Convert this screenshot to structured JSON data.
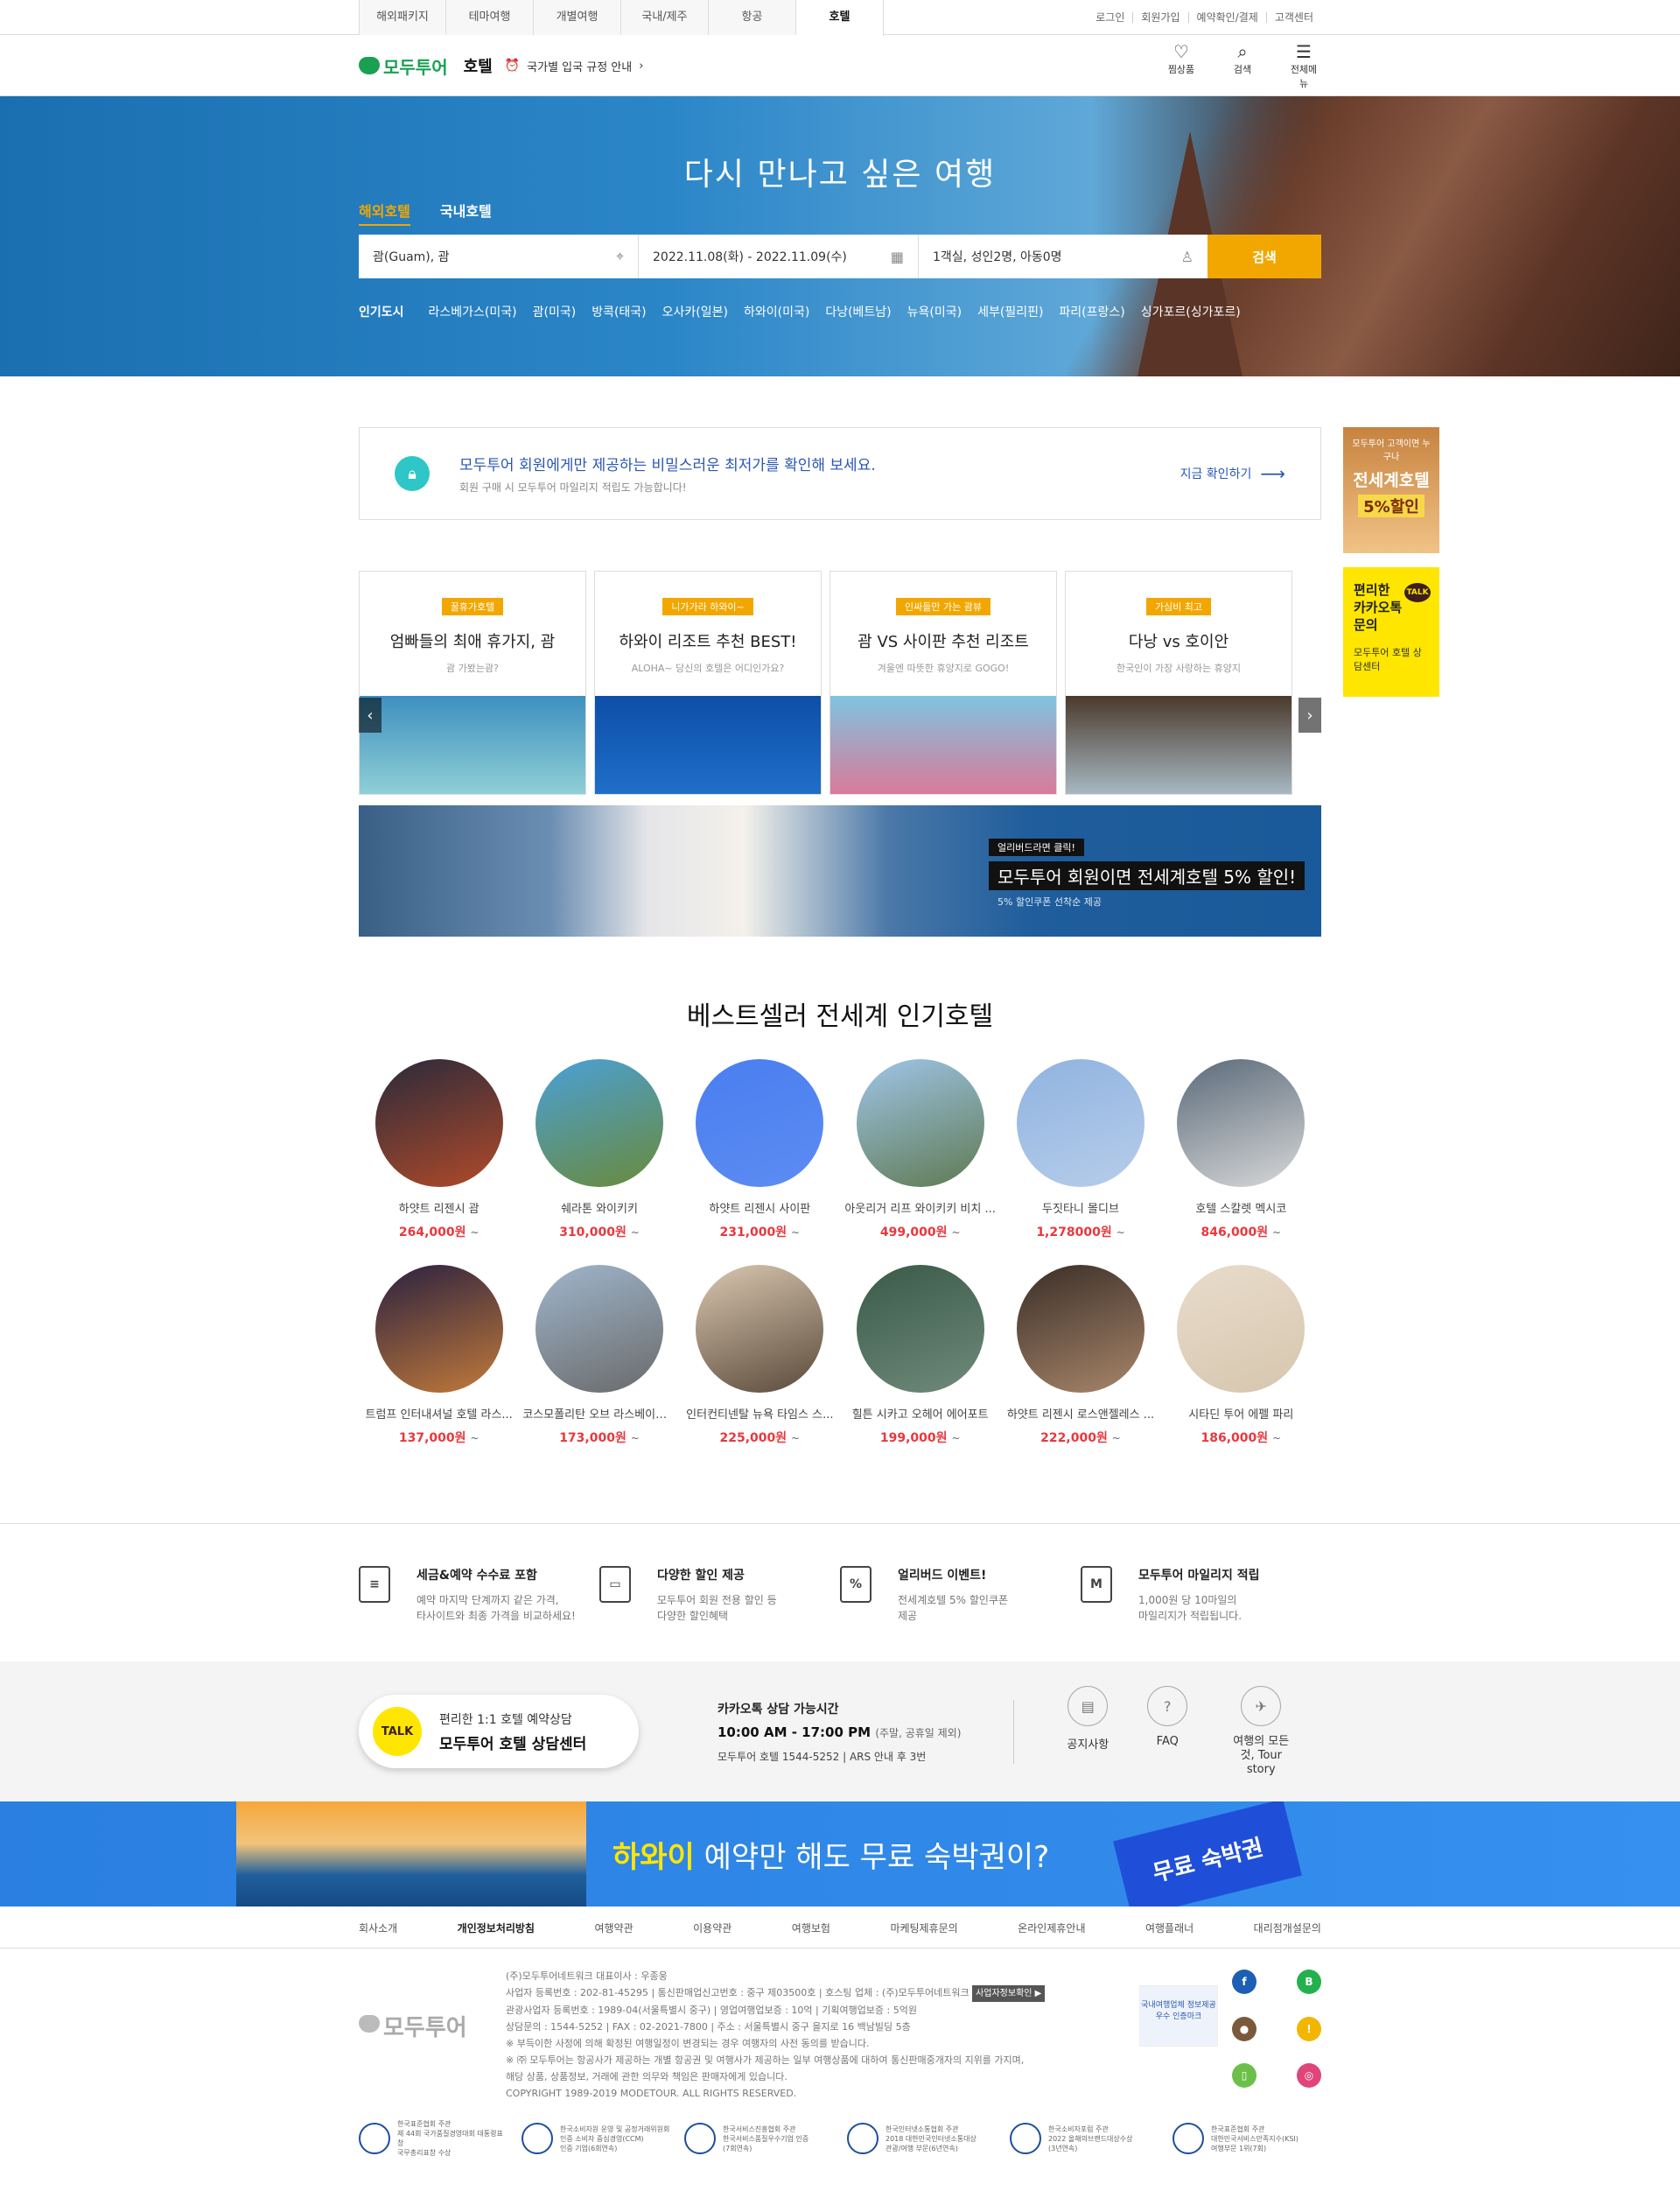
{
  "top_tabs": [
    "해외패키지",
    "테마여행",
    "개별여행",
    "국내/제주",
    "항공",
    "호텔"
  ],
  "top_active": "호텔",
  "util_links": [
    "로그인",
    "회원가입",
    "예약확인/결제",
    "고객센터"
  ],
  "header": {
    "logo": "모두투어",
    "section": "호텔",
    "entry_notice": "국가별 입국 규정 안내",
    "icons": [
      {
        "icon": "heart-icon",
        "label": "찜상품"
      },
      {
        "icon": "search-icon",
        "label": "검색"
      },
      {
        "icon": "menu-icon",
        "label": "전체메뉴"
      }
    ]
  },
  "hero": {
    "title": "다시 만나고 싶은 여행",
    "tabs": [
      "해외호텔",
      "국내호텔"
    ],
    "destination": "괌(Guam), 괌",
    "dates": "2022.11.08(화) - 2022.11.09(수)",
    "guests": "1객실, 성인2명, 아동0명",
    "search_btn": "검색",
    "popular_label": "인기도시",
    "popular_cities": [
      "라스베가스(미국)",
      "괌(미국)",
      "방콕(태국)",
      "오사카(일본)",
      "하와이(미국)",
      "다낭(베트남)",
      "뉴욕(미국)",
      "세부(필리핀)",
      "파리(프랑스)",
      "싱가포르(싱가포르)"
    ]
  },
  "member": {
    "title": "모두투어 회원에게만 제공하는 비밀스러운 최저가를 확인해 보세요.",
    "sub": "회원 구매 시 모두투어 마일리지 적립도 가능합니다!",
    "link": "지금 확인하기"
  },
  "side": {
    "b1_top": "모두투어 고객이면 누구나",
    "b1_title": "전세계호텔",
    "b1_badge": "5%할인",
    "b2_title": "편리한 카카오톡 문의",
    "b2_sub": "모두투어 호텔 상담센터",
    "b2_talk": "TALK"
  },
  "cards": [
    {
      "tag": "꿀휴가호텔",
      "title": "엄빠들의 최애 휴가지, 괌",
      "sub": "괌 가봤는괌?",
      "color1": "#3e8fc0",
      "color2": "#8fd0d6"
    },
    {
      "tag": "니가가라 하와이~",
      "title": "하와이 리조트 추천 BEST!",
      "sub": "ALOHA~ 당신의 호텔은 어디인가요?",
      "color1": "#0d4ea8",
      "color2": "#1f6fc9"
    },
    {
      "tag": "인싸들만 가는 괌뷰",
      "title": "괌 VS 사이판 추천 리조트",
      "sub": "겨울엔 따뜻한 휴양지로 GOGO!",
      "color1": "#7fc4e0",
      "color2": "#d97a9a"
    },
    {
      "tag": "가심비 최고",
      "title": "다낭 vs 호이안",
      "sub": "한국인이 가장 사랑하는 휴양지",
      "color1": "#4a3a2c",
      "color2": "#a7b8c2"
    }
  ],
  "banner": {
    "label": "얼리버드라면 클릭!",
    "title": "모두투어 회원이면 전세계호텔 5% 할인!",
    "sub": "5% 할인쿠폰 선착순 제공"
  },
  "best": {
    "title": "베스트셀러 전세계 인기호텔",
    "hotels": [
      {
        "name": "하얏트 리젠시 괌",
        "price": "264,000원",
        "c1": "#2a2a3a",
        "c2": "#b04a2a"
      },
      {
        "name": "쉐라톤 와이키키",
        "price": "310,000원",
        "c1": "#4aa0d8",
        "c2": "#6a8a3a"
      },
      {
        "name": "하얏트 리젠시 사이판",
        "price": "231,000원",
        "c1": "#4a7ef0",
        "c2": "#5c8cf2"
      },
      {
        "name": "아웃리거 리프 와이키키 비치 ...",
        "price": "499,000원",
        "c1": "#9fc5e8",
        "c2": "#5f7a52"
      },
      {
        "name": "두짓타니 몰디브",
        "price": "1,278000원",
        "c1": "#8fb3e0",
        "c2": "#b7cdea"
      },
      {
        "name": "호텔 스칼렛 멕시코",
        "price": "846,000원",
        "c1": "#5a6a7a",
        "c2": "#d8d8d8"
      },
      {
        "name": "트럼프 인터내셔널 호텔 라스...",
        "price": "137,000원",
        "c1": "#2a2140",
        "c2": "#c27a3a"
      },
      {
        "name": "코스모폴리탄 오브 라스베이거...",
        "price": "173,000원",
        "c1": "#9fb6cc",
        "c2": "#6a6a6a"
      },
      {
        "name": "인터컨티넨탈 뉴욕 타임스 스...",
        "price": "225,000원",
        "c1": "#d9c7b0",
        "c2": "#5a4a3a"
      },
      {
        "name": "힐튼 시카고 오헤어 에어포트",
        "price": "199,000원",
        "c1": "#3a5a48",
        "c2": "#6f8a7a"
      },
      {
        "name": "하얏트 리젠시 로스앤젤레스 ...",
        "price": "222,000원",
        "c1": "#3a2e28",
        "c2": "#a8866a"
      },
      {
        "name": "시타딘 투어 에펠 파리",
        "price": "186,000원",
        "c1": "#e8dccb",
        "c2": "#d6c6ae"
      }
    ],
    "price_suffix": "~"
  },
  "features": [
    {
      "icon": "receipt-icon",
      "glyph": "≡",
      "title": "세금&예약 수수료 포함",
      "desc1": "예약 마지막 단계까지 같은 가격,",
      "desc2": "타사이트와 최종 가격을 비교하세요!"
    },
    {
      "icon": "card-icon",
      "glyph": "▭",
      "title": "다양한 할인 제공",
      "desc1": "모두투어 회원 전용 할인 등",
      "desc2": "다양한 할인혜택"
    },
    {
      "icon": "coupon-icon",
      "glyph": "%",
      "title": "얼리버드 이벤트!",
      "desc1": "전세계호텔 5% 할인쿠폰",
      "desc2": "제공"
    },
    {
      "icon": "coins-icon",
      "glyph": "M",
      "title": "모두투어 마일리지 적립",
      "desc1": "1,000원 당 10마일의",
      "desc2": "마일리지가 적립됩니다."
    }
  ],
  "consult": {
    "talk": "TALK",
    "t1": "편리한 1:1 호텔 예약상담",
    "t2": "모두투어 호텔 상담센터",
    "hours_title": "카카오톡 상담 가능시간",
    "hours": "10:00 AM - 17:00 PM",
    "hours_note": "(주말, 공휴일 제외)",
    "phone": "모두투어 호텔 1544-5252  |  ARS 안내 후 3번",
    "links": [
      {
        "icon": "notice-icon",
        "glyph": "▤",
        "label": "공지사항"
      },
      {
        "icon": "faq-icon",
        "glyph": "?",
        "label": "FAQ"
      },
      {
        "icon": "plane-icon",
        "glyph": "✈",
        "label": "여행의 모든것, Tour story"
      }
    ]
  },
  "hawaii": {
    "hl": "하와이",
    "text": "예약만 해도 무료 숙박권이?",
    "ticket": "무료 숙박권"
  },
  "footer": {
    "links": [
      "회사소개",
      "개인정보처리방침",
      "여행약관",
      "이용약관",
      "여행보험",
      "마케팅제휴문의",
      "온라인제휴안내",
      "여행플래너",
      "대리점개설문의"
    ],
    "bold_link": "개인정보처리방침",
    "logo": "모두투어",
    "lines": [
      "(주)모두투어네트워크 대표이사 : 우종웅",
      "사업자 등록번호 : 202-81-45295 | 통신판매업신고번호 : 중구 제03500호 | 호스팅 업체 : (주)모두투어네트워크",
      "관광사업자 등록번호 : 1989-04(서울특별시 중구) | 영업여행업보증 : 10억 | 기획여행업보증 : 5억원",
      "상담문의 : 1544-5252 | FAX : 02-2021-7800 | 주소 : 서울특별시 중구 을지로 16 백남빌딩 5층",
      "※ 부득이한 사정에 의해 확정된 여행일정이 변경되는 경우 여행자의 사전 동의를 받습니다.",
      "※ ㈜ 모두투어는 항공사가 제공하는 개별 항공권 및 여행사가 제공하는 일부 여행상품에 대하여 통신판매중개자의 지위를 가지며,",
      "해당 상품, 상품정보, 거래에 관한 의무와 책임은 판매자에게 있습니다.",
      "COPYRIGHT 1989-2019 MODETOUR. ALL RIGHTS RESERVED."
    ],
    "biz_tag": "사업자정보확인 ▶",
    "cert": "국내여행업체 정보제공 우수 인증마크",
    "socials": [
      {
        "icon": "facebook-icon",
        "glyph": "f",
        "color": "#1d5fb4"
      },
      {
        "icon": "blog-icon",
        "glyph": "B",
        "color": "#23b14d"
      },
      {
        "icon": "chat-icon",
        "glyph": "●",
        "color": "#7a5a3a"
      },
      {
        "icon": "kakaostory-icon",
        "glyph": "!",
        "color": "#f2b600"
      },
      {
        "icon": "post-icon",
        "glyph": "▯",
        "color": "#6cc04a"
      },
      {
        "icon": "instagram-icon",
        "glyph": "◎",
        "color": "#e0457a"
      }
    ],
    "awards": [
      {
        "t1": "한국표준협회 주관",
        "t2": "제 44회 국가품질경영대회 대통령표창",
        "t3": "국무총리표창 수상"
      },
      {
        "t1": "한국소비자원 운영 및 공정거래위원회",
        "t2": "인증 소비자 중심경영(CCM)",
        "t3": "인증 기업(6회연속)"
      },
      {
        "t1": "한국서비스진흥협회 주관",
        "t2": "한국서비스품질우수기업 인증",
        "t3": "(7회연속)"
      },
      {
        "t1": "한국인터넷소통협회 주관",
        "t2": "2018 대한민국인터넷소통대상",
        "t3": "관광/여행 부문(6년연속)"
      },
      {
        "t1": "한국소비자포럼 주관",
        "t2": "2022 올해의브랜드대상수상",
        "t3": "(3년연속)"
      },
      {
        "t1": "한국표준협회 주관",
        "t2": "대한민국서비스만족지수(KSI)",
        "t3": "여행부문 1위(7회)"
      }
    ]
  }
}
